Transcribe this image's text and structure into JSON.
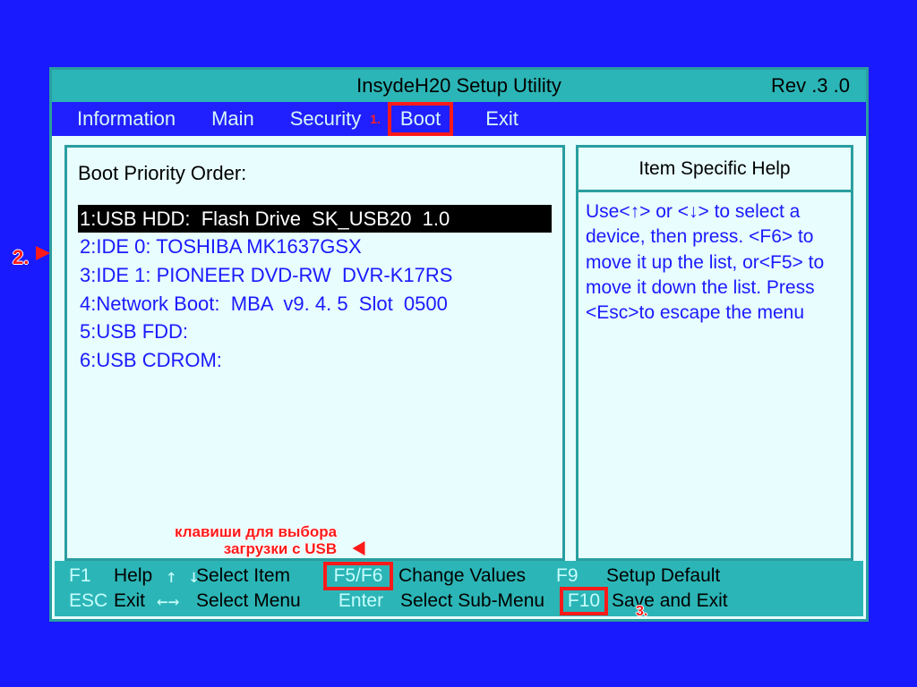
{
  "title": {
    "center": "InsydeH20  Setup  Utility",
    "rev": "Rev .3 .0"
  },
  "tabs": {
    "information": "Information",
    "main": "Main",
    "security": "Security",
    "boot": "Boot",
    "exit": "Exit",
    "marker1": "1."
  },
  "boot": {
    "heading": "Boot Priority Order:",
    "items": [
      "1:USB HDD:  Flash Drive  SK_USB20  1.0",
      "2:IDE 0: TOSHIBA MK1637GSX",
      "3:IDE 1: PIONEER DVD-RW  DVR-K17RS",
      "4:Network Boot:  MBA  v9. 4. 5  Slot  0500",
      "5:USB FDD:",
      "6:USB CDROM:"
    ]
  },
  "help": {
    "title": "Item Specific Help",
    "body": "Use<↑> or <↓> to select a device,  then press. <F6> to move it up the list, or<F5> to move it down the list. Press <Esc>to escape the menu"
  },
  "footer": {
    "f1": "F1",
    "help": "Help",
    "select_item": "Select Item",
    "f5f6": "F5/F6",
    "change_values": "Change Values",
    "f9": "F9",
    "setup_default": "Setup Default",
    "esc": "ESC",
    "exit": "Exit",
    "select_menu": "Select Menu",
    "enter": "Enter",
    "select_submenu": "Select  Sub-Menu",
    "f10": "F10",
    "save_exit": "Save and Exit"
  },
  "annotations": {
    "marker2": "2.",
    "marker3": "3.",
    "usb_note_line1": "клавиши для выбора",
    "usb_note_line2": "загрузки с USB"
  }
}
